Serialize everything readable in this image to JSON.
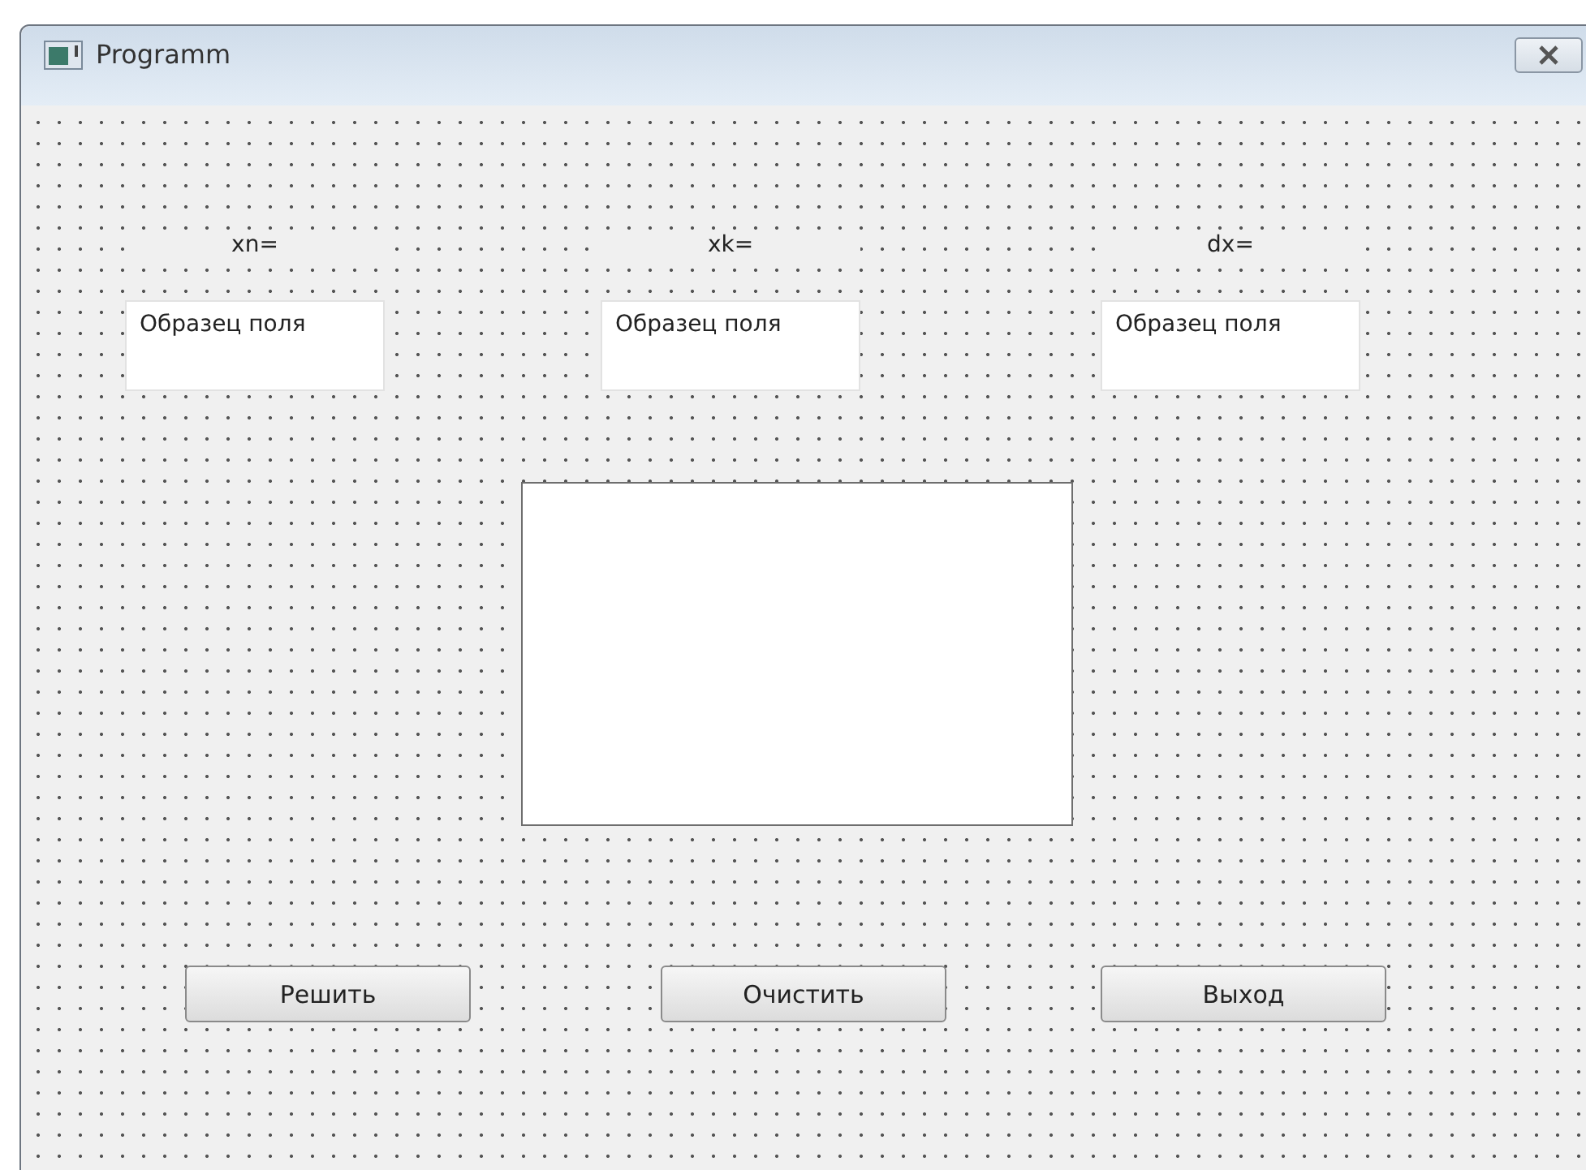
{
  "window": {
    "title": "Programm"
  },
  "inputs": [
    {
      "label": "xn=",
      "value": "Образец поля"
    },
    {
      "label": "xk=",
      "value": "Образец поля"
    },
    {
      "label": "dx=",
      "value": "Образец поля"
    }
  ],
  "buttons": [
    "Решить",
    "Очистить",
    "Выход"
  ]
}
